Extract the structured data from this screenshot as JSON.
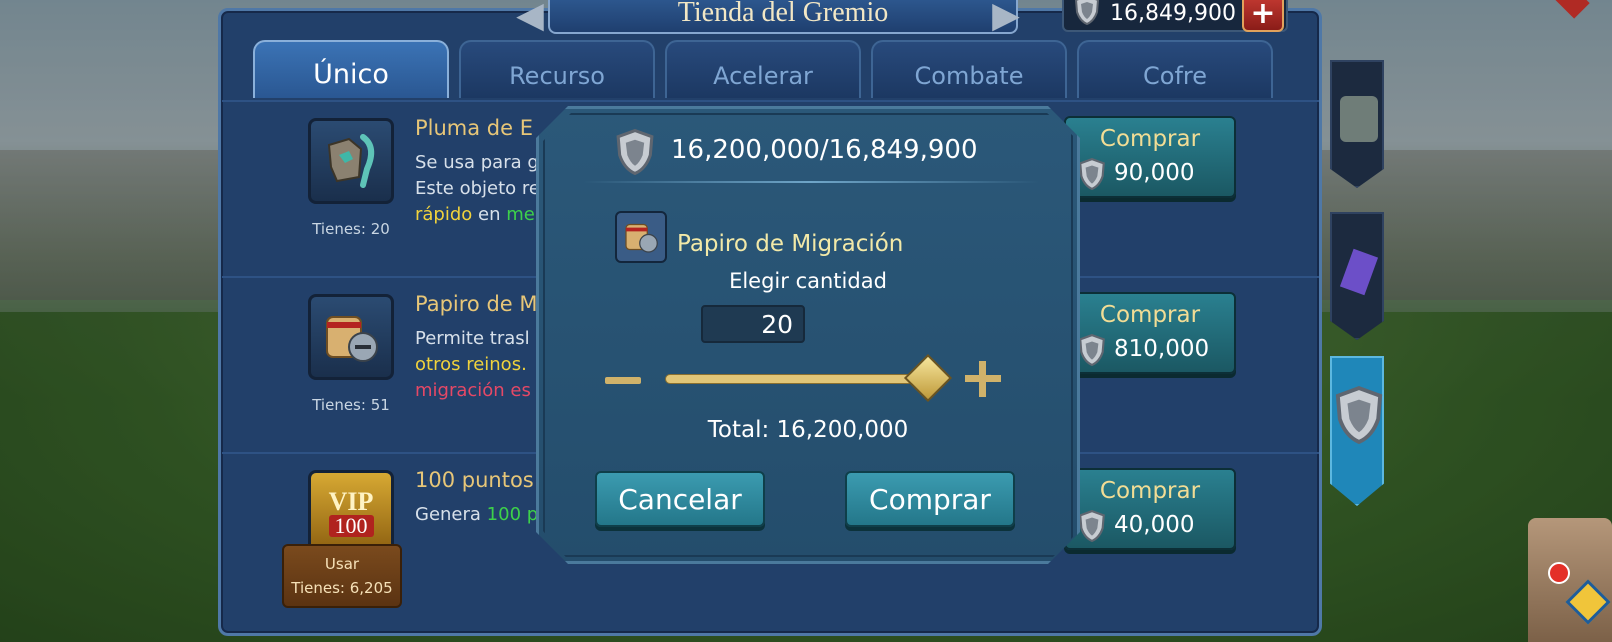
{
  "header": {
    "title": "Tienda del Gremio",
    "currency_amount": "16,849,900",
    "plus_label": "+"
  },
  "tabs": [
    {
      "label": "Único",
      "active": true
    },
    {
      "label": "Recurso",
      "active": false
    },
    {
      "label": "Acelerar",
      "active": false
    },
    {
      "label": "Combate",
      "active": false
    },
    {
      "label": "Cofre",
      "active": false
    }
  ],
  "items": [
    {
      "name": "Pluma de E",
      "desc_line1": "Se usa para g",
      "desc_line2": "Este objeto re",
      "desc_line3_a": "rápido",
      "desc_line3_b": " en ",
      "desc_line3_c": "me",
      "have": "Tienes: 20",
      "buy_label": "Comprar",
      "price": "90,000",
      "icon": "feather-armor-icon"
    },
    {
      "name": "Papiro de M",
      "desc_line1": "Permite trasl",
      "desc_line2": "otros reinos.",
      "desc_line3": "migración es",
      "have": "Tienes: 51",
      "buy_label": "Comprar",
      "price": "810,000",
      "icon": "scroll-helmet-icon"
    },
    {
      "name": "100 puntos",
      "desc_a": "Genera ",
      "desc_b": "100 p",
      "badge_top": "VIP",
      "badge_bottom": "100",
      "use_label": "Usar",
      "have": "Tienes: 6,205",
      "buy_label": "Comprar",
      "price": "40,000",
      "icon": "vip-badge-icon"
    }
  ],
  "dialog": {
    "balance": "16,200,000/16,849,900",
    "item_name": "Papiro de Migración",
    "choose_label": "Elegir cantidad",
    "quantity": "20",
    "slider_fraction": 1.0,
    "total": "Total: 16,200,000",
    "cancel_label": "Cancelar",
    "buy_label": "Comprar"
  },
  "colors": {
    "panel": "#22406a",
    "accent_gold": "#e7c678",
    "button_teal": "#2a8090",
    "highlight_green": "#3dd14a",
    "highlight_red": "#e54866"
  }
}
